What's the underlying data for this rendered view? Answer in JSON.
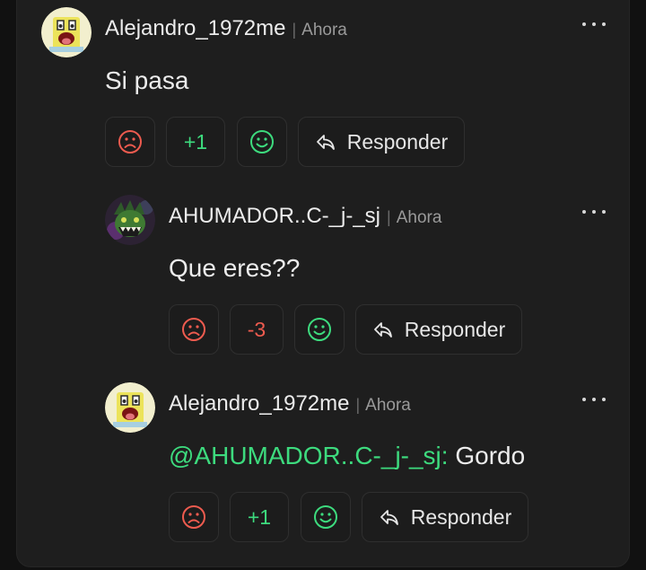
{
  "colors": {
    "background": "#111111",
    "card": "#1e1e1e",
    "positive": "#3ddb7e",
    "negative": "#ee5b4f",
    "text": "#ececec",
    "muted": "#9a9a9a"
  },
  "comments": [
    {
      "username": "Alejandro_1972me",
      "separator": "|",
      "time": "Ahora",
      "text": "Si pasa",
      "mention": "",
      "score": "+1",
      "reply_label": "Responder",
      "avatar_icon": "sponge-avatar-icon",
      "more_icon": "more-dots-icon"
    },
    {
      "username": "AHUMADOR..C-_j-_sj",
      "separator": "|",
      "time": "Ahora",
      "text": "Que eres??",
      "mention": "",
      "score": "-3",
      "reply_label": "Responder",
      "avatar_icon": "monster-avatar-icon",
      "more_icon": "more-dots-icon"
    },
    {
      "username": "Alejandro_1972me",
      "separator": "|",
      "time": "Ahora",
      "text": "Gordo",
      "mention": "@AHUMADOR..C-_j-_sj:",
      "score": "+1",
      "reply_label": "Responder",
      "avatar_icon": "sponge-avatar-icon",
      "more_icon": "more-dots-icon"
    }
  ]
}
